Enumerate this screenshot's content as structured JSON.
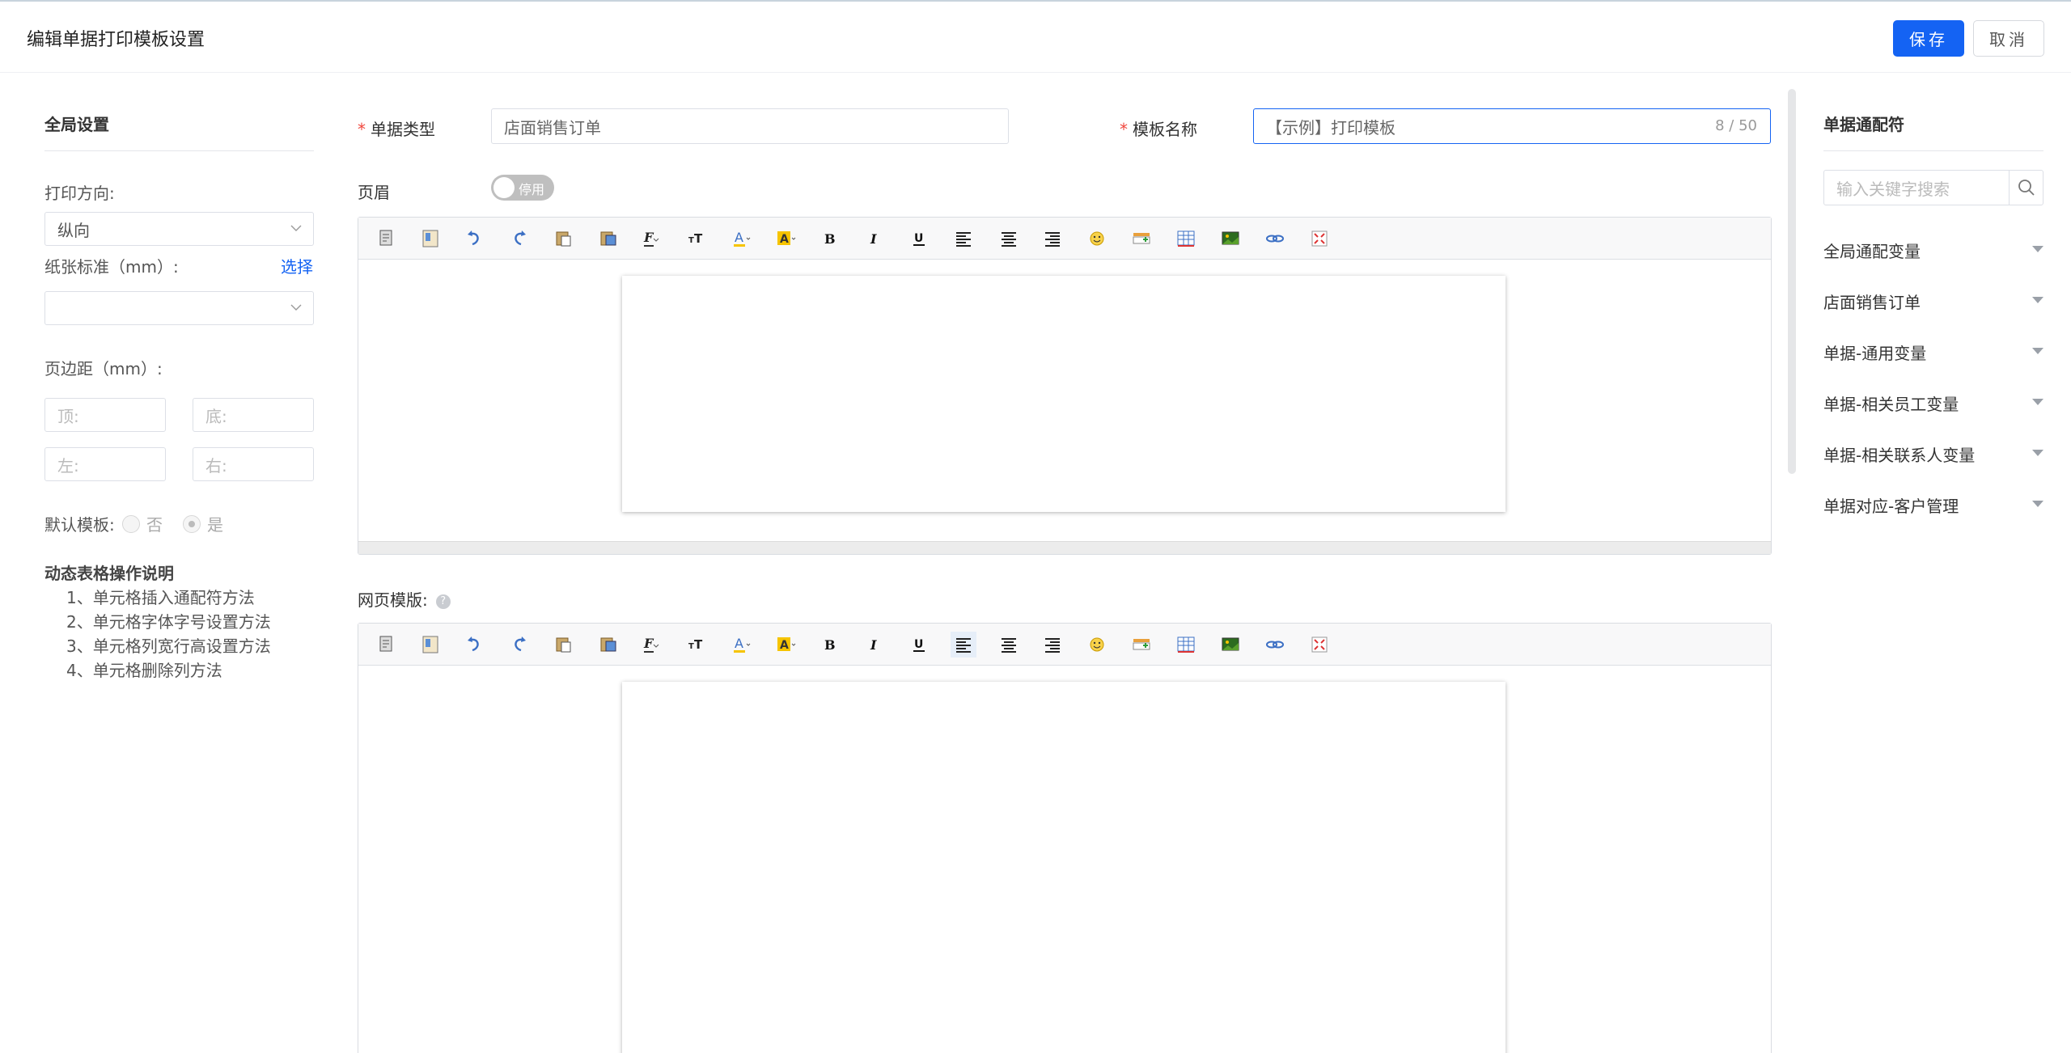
{
  "header": {
    "title": "编辑单据打印模板设置",
    "save_label": "保存",
    "cancel_label": "取消"
  },
  "left": {
    "section_title": "全局设置",
    "print_direction_label": "打印方向:",
    "print_direction_value": "纵向",
    "paper_label": "纸张标准（mm）:",
    "paper_select_link": "选择",
    "paper_value": "",
    "margin_label": "页边距（mm）:",
    "margin_top_placeholder": "顶:",
    "margin_bottom_placeholder": "底:",
    "margin_left_placeholder": "左:",
    "margin_right_placeholder": "右:",
    "default_template_label": "默认模板:",
    "default_no": "否",
    "default_yes": "是",
    "howto_title": "动态表格操作说明",
    "howto_items": [
      "1、单元格插入通配符方法",
      "2、单元格字体字号设置方法",
      "3、单元格列宽行高设置方法",
      "4、单元格删除列方法"
    ]
  },
  "main": {
    "doc_type_label": "单据类型",
    "doc_type_value": "店面销售订单",
    "template_name_label": "模板名称",
    "template_name_value": "【示例】打印模板",
    "template_name_count": "8 / 50",
    "header_label": "页眉",
    "header_toggle_text": "停用",
    "web_template_label": "网页模版:",
    "help_glyph": "?"
  },
  "right": {
    "title": "单据通配符",
    "search_placeholder": "输入关键字搜索",
    "items": [
      "全局通配变量",
      "店面销售订单",
      "单据-通用变量",
      "单据-相关员工变量",
      "单据-相关联系人变量",
      "单据对应-客户管理"
    ]
  },
  "toolbar_icons": [
    "source-icon",
    "template-icon",
    "undo-icon",
    "redo-icon",
    "paste-icon",
    "paste-text-icon",
    "font-family-icon",
    "font-size-icon",
    "font-color-icon",
    "highlight-icon",
    "bold-icon",
    "italic-icon",
    "underline-icon",
    "align-left-icon",
    "align-center-icon",
    "align-right-icon",
    "emoji-icon",
    "insert-row-icon",
    "table-icon",
    "image-icon",
    "link-icon",
    "fullscreen-icon"
  ],
  "colors": {
    "primary": "#1463f3",
    "required": "#f0483e",
    "toggle_off": "#bfbfbf"
  }
}
